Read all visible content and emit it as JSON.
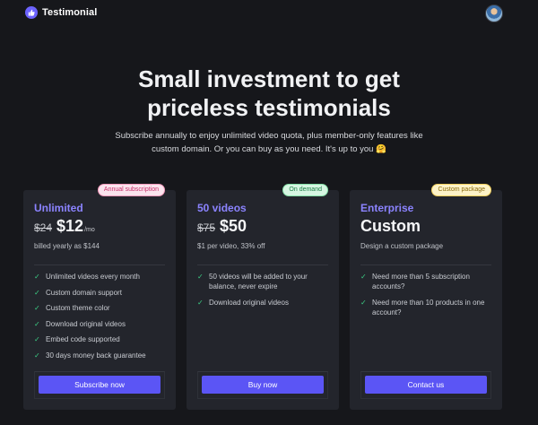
{
  "header": {
    "brand": "Testimonial",
    "brand_icon": "thumbs-up-icon",
    "avatar": "user-avatar"
  },
  "hero": {
    "title_line1": "Small investment to get",
    "title_line2": "priceless testimonials",
    "subtitle_line1": "Subscribe annually to enjoy unlimited video quota, plus member-only features like",
    "subtitle_line2": "custom domain. Or you can buy as you need. It's up to you 🤗"
  },
  "plans": [
    {
      "badge": "Annual subscription",
      "name": "Unlimited",
      "old_price": "$24",
      "price": "$12",
      "unit": "/mo",
      "note": "billed yearly as $144",
      "features": [
        "Unlimited videos every month",
        "Custom domain support",
        "Custom theme color",
        "Download original videos",
        "Embed code supported",
        "30 days money back guarantee"
      ],
      "cta": "Subscribe now"
    },
    {
      "badge": "On demand",
      "name": "50 videos",
      "old_price": "$75",
      "price": "$50",
      "note": "$1 per video, 33% off",
      "features": [
        "50 videos will be added to your balance, never expire",
        "Download original videos"
      ],
      "cta": "Buy now"
    },
    {
      "badge": "Custom package",
      "name": "Enterprise",
      "price": "Custom",
      "note": "Design a custom package",
      "features": [
        "Need more than 5 subscription accounts?",
        "Need more than 10 products in one account?"
      ],
      "cta": "Contact us"
    }
  ],
  "colors": {
    "accent": "#5b55f5",
    "plan_name": "#8b83ff",
    "check": "#3ccf85",
    "background": "#16171b",
    "card": "#23252c"
  }
}
